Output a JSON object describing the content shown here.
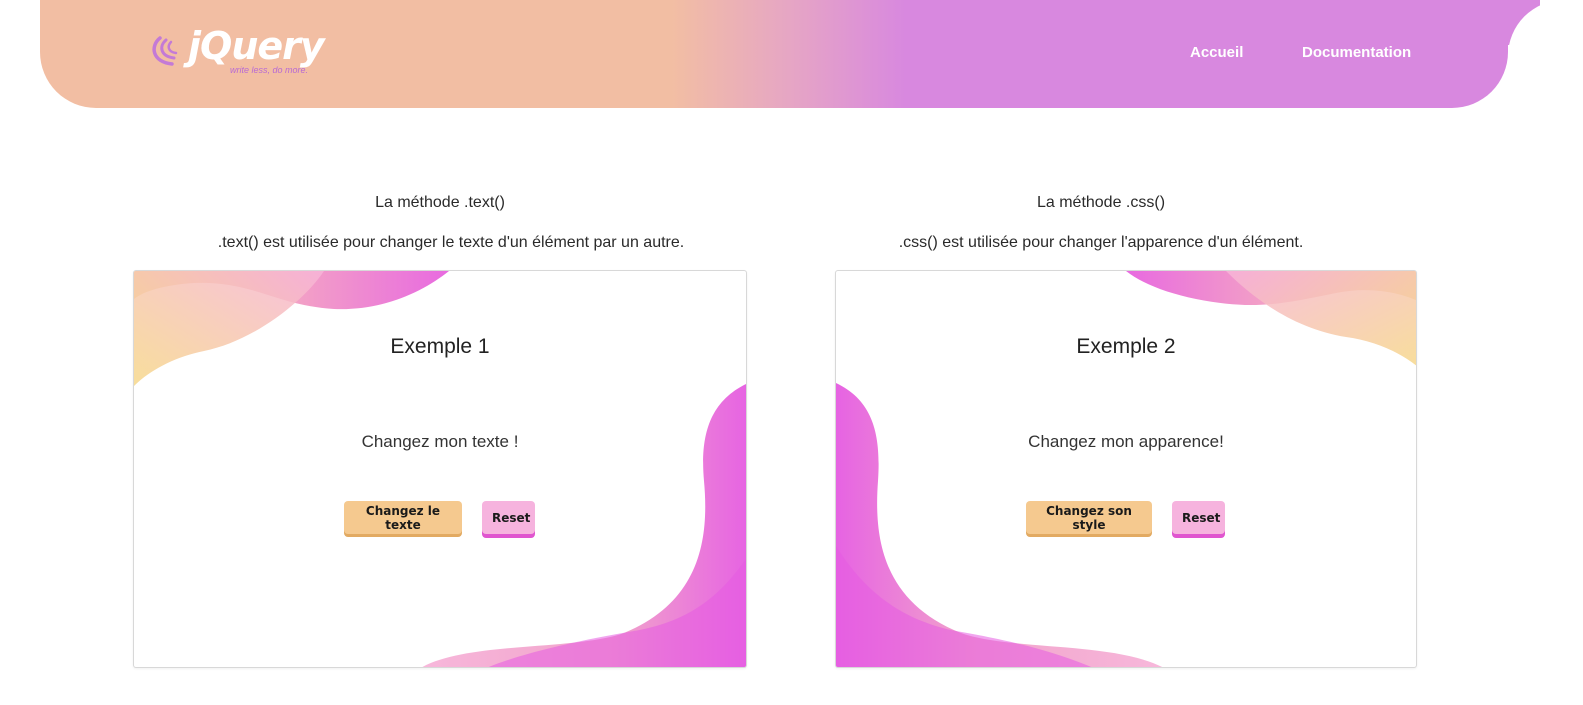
{
  "header": {
    "logo": {
      "word": "jQuery",
      "tagline": "write less, do more."
    },
    "nav": [
      {
        "label": "Accueil"
      },
      {
        "label": "Documentation"
      }
    ],
    "colors": {
      "peach": "#f2bea3",
      "violet": "#d888df"
    }
  },
  "sections": [
    {
      "heading": "La méthode .text()",
      "description": ".text() est utilisée pour changer le texte d'un élément par un autre.",
      "card": {
        "title": "Exemple 1",
        "text": "Changez mon texte !",
        "primary_button": "Changez le texte",
        "reset_button": "Reset"
      }
    },
    {
      "heading": "La méthode .css()",
      "description": ".css() est utilisée pour changer l'apparence d'un élément.",
      "card": {
        "title": "Exemple 2",
        "text": "Changez mon apparence!",
        "primary_button": "Changez son style",
        "reset_button": "Reset"
      }
    }
  ],
  "colors": {
    "button_primary": "#f5c98f",
    "button_reset": "#f6b3de",
    "blob_yellow": "#f5d98a",
    "blob_pink": "#f7b4d9",
    "blob_magenta": "#e55be1"
  }
}
